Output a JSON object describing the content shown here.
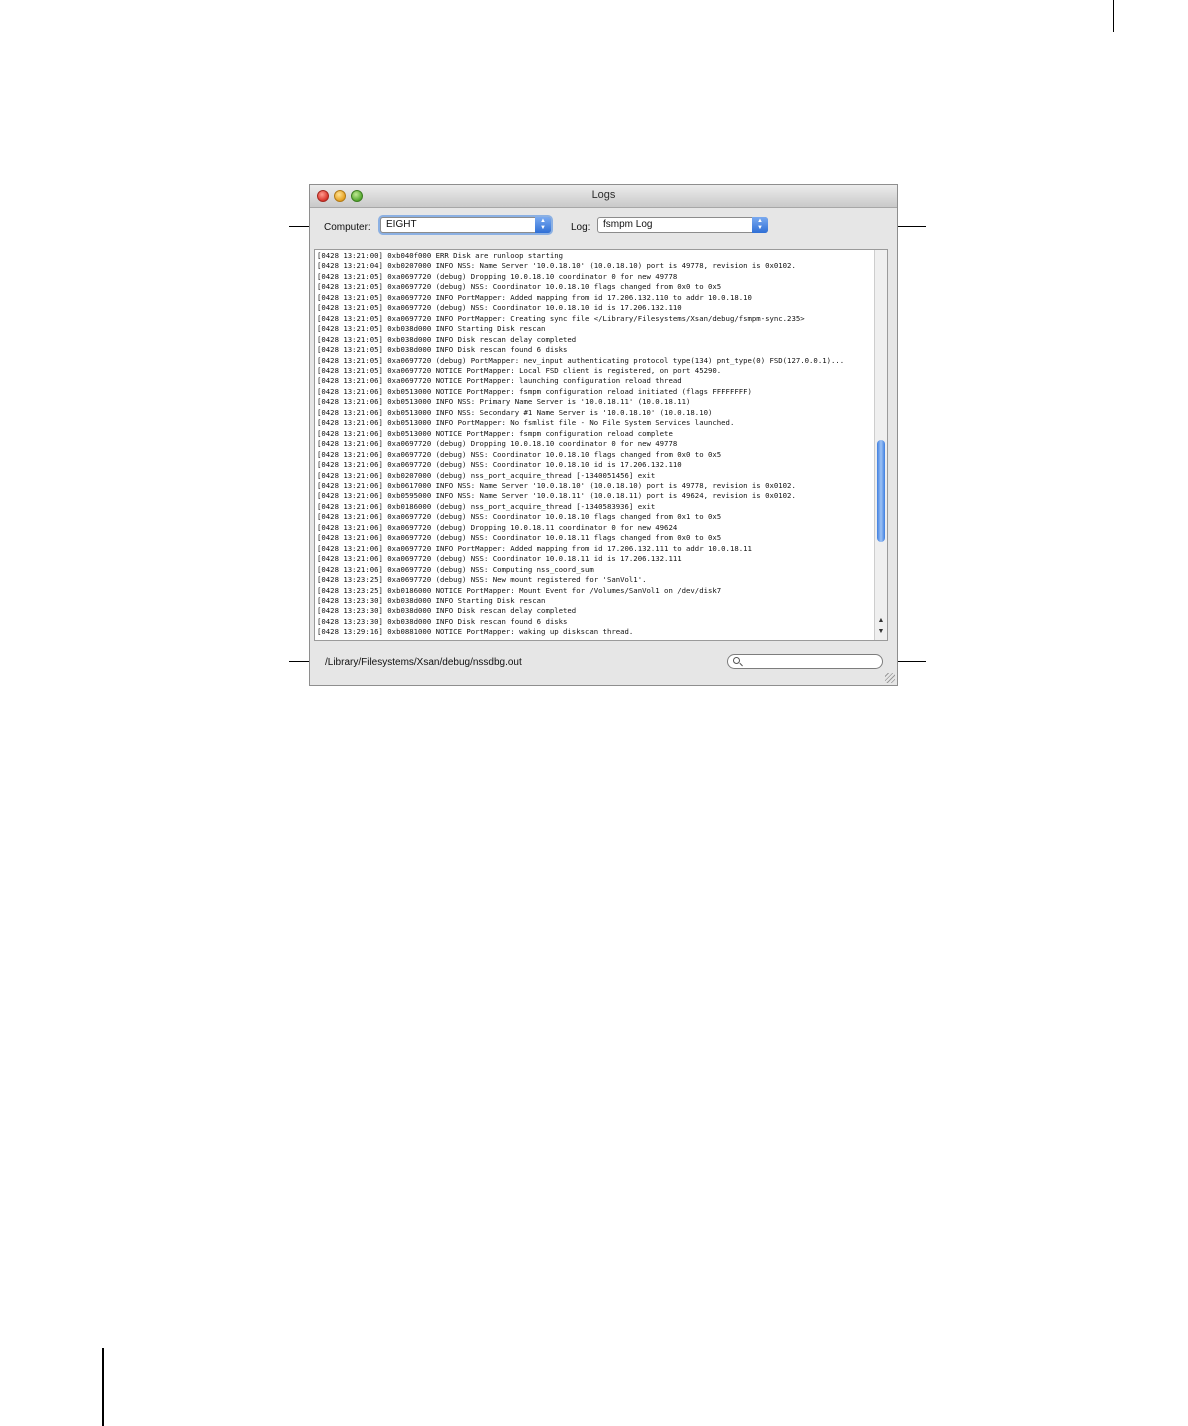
{
  "window": {
    "title": "Logs"
  },
  "toolbar": {
    "computer_label": "Computer:",
    "computer_value": "EIGHT",
    "log_label": "Log:",
    "log_value": "fsmpm Log"
  },
  "log_lines": [
    "[0428 13:21:00] 0xb040f000 ERR Disk are runloop starting",
    "[0428 13:21:04] 0xb0207000 INFO NSS: Name Server '10.0.18.10' (10.0.18.10) port is 49778, revision is 0x0102.",
    "[0428 13:21:05] 0xa0697720 (debug) Dropping 10.0.18.10 coordinator 0 for new 49778",
    "[0428 13:21:05] 0xa0697720 (debug) NSS: Coordinator 10.0.18.10 flags changed from 0x0 to 0x5",
    "[0428 13:21:05] 0xa0697720 INFO PortMapper: Added mapping from id 17.206.132.110 to addr 10.0.18.10",
    "[0428 13:21:05] 0xa0697720 (debug) NSS: Coordinator 10.0.18.10 id is 17.206.132.110",
    "[0428 13:21:05] 0xa0697720 INFO PortMapper: Creating sync file </Library/Filesystems/Xsan/debug/fsmpm-sync.235>",
    "[0428 13:21:05] 0xb038d000 INFO Starting Disk rescan",
    "[0428 13:21:05] 0xb038d000 INFO Disk rescan delay completed",
    "[0428 13:21:05] 0xb038d000 INFO Disk rescan found 6 disks",
    "[0428 13:21:05] 0xa0697720 (debug) PortMapper: nev_input authenticating protocol type(134) pnt_type(0) FSD(127.0.0.1)...",
    "[0428 13:21:05] 0xa0697720 NOTICE PortMapper: Local FSD client is registered, on port 45290.",
    "[0428 13:21:06] 0xa0697720 NOTICE PortMapper: launching configuration reload thread",
    "[0428 13:21:06] 0xb0513000 NOTICE PortMapper: fsmpm configuration reload initiated (flags FFFFFFFF)",
    "[0428 13:21:06] 0xb0513000 INFO NSS: Primary Name Server is '10.0.18.11' (10.0.18.11)",
    "[0428 13:21:06] 0xb0513000 INFO NSS: Secondary #1 Name Server is '10.0.18.10' (10.0.18.10)",
    "[0428 13:21:06] 0xb0513000 INFO PortMapper: No fsmlist file - No File System Services launched.",
    "[0428 13:21:06] 0xb0513000 NOTICE PortMapper: fsmpm configuration reload complete",
    "[0428 13:21:06] 0xa0697720 (debug) Dropping 10.0.18.10 coordinator 0 for new 49778",
    "[0428 13:21:06] 0xa0697720 (debug) NSS: Coordinator 10.0.18.10 flags changed from 0x0 to 0x5",
    "[0428 13:21:06] 0xa0697720 (debug) NSS: Coordinator 10.0.18.10 id is 17.206.132.110",
    "[0428 13:21:06] 0xb0207000 (debug) nss_port_acquire_thread [-1340051456] exit",
    "[0428 13:21:06] 0xb0617000 INFO NSS: Name Server '10.0.18.10' (10.0.18.10) port is 49778, revision is 0x0102.",
    "[0428 13:21:06] 0xb0595000 INFO NSS: Name Server '10.0.18.11' (10.0.18.11) port is 49624, revision is 0x0102.",
    "[0428 13:21:06] 0xb0186000 (debug) nss_port_acquire_thread [-1340583936] exit",
    "[0428 13:21:06] 0xa0697720 (debug) NSS: Coordinator 10.0.18.10 flags changed from 0x1 to 0x5",
    "[0428 13:21:06] 0xa0697720 (debug) Dropping 10.0.18.11 coordinator 0 for new 49624",
    "[0428 13:21:06] 0xa0697720 (debug) NSS: Coordinator 10.0.18.11 flags changed from 0x0 to 0x5",
    "[0428 13:21:06] 0xa0697720 INFO PortMapper: Added mapping from id 17.206.132.111 to addr 10.0.18.11",
    "[0428 13:21:06] 0xa0697720 (debug) NSS: Coordinator 10.0.18.11 id is 17.206.132.111",
    "[0428 13:21:06] 0xa0697720 (debug) NSS: Computing nss_coord_sum",
    "[0428 13:23:25] 0xa0697720 (debug) NSS: New mount registered for 'SanVol1'.",
    "[0428 13:23:25] 0xb0186000 NOTICE PortMapper: Mount Event for /Volumes/SanVol1 on /dev/disk7",
    "[0428 13:23:30] 0xb038d000 INFO Starting Disk rescan",
    "[0428 13:23:30] 0xb038d000 INFO Disk rescan delay completed",
    "[0428 13:23:30] 0xb038d000 INFO Disk rescan found 6 disks",
    "[0428 13:29:16] 0xb0881000 NOTICE PortMapper: waking up diskscan thread."
  ],
  "status": {
    "path": "/Library/Filesystems/Xsan/debug/nssdbg.out"
  },
  "search": {
    "value": "",
    "placeholder": ""
  },
  "icons": [
    "search-icon",
    "popup-arrows-icon",
    "resize-grip-icon",
    "scroll-up-icon",
    "scroll-down-icon"
  ]
}
